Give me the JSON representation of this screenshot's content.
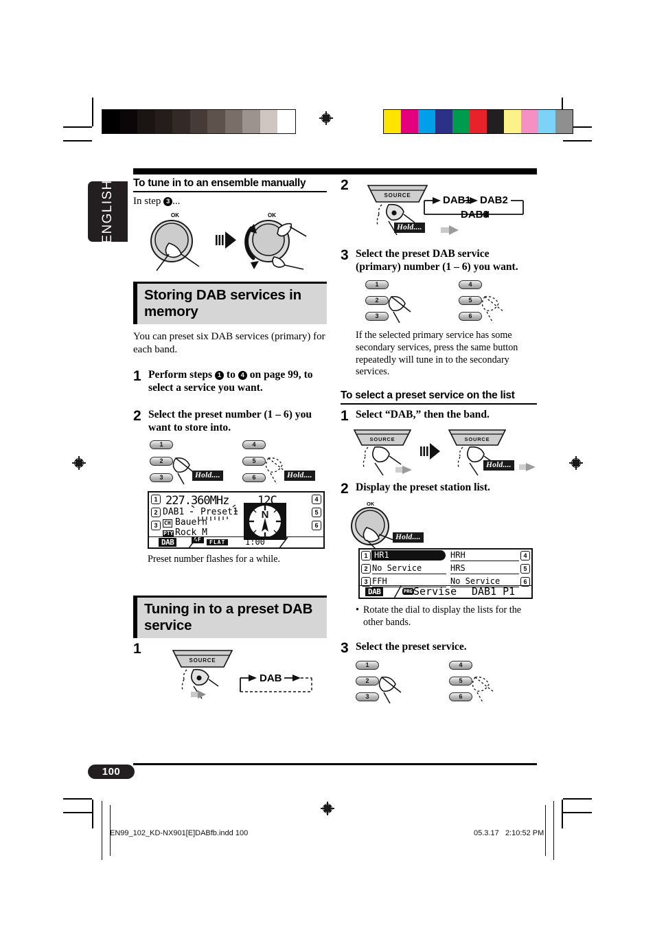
{
  "document": {
    "language_tab": "ENGLISH",
    "page_number": "100",
    "footer_file": "EN99_102_KD-NX901[E]DABfb.indd   100",
    "footer_date": "05.3.17",
    "footer_time": "2:10:52 PM"
  },
  "colors": {
    "accent_band_bg": "#d6d6d6",
    "rule_black": "#000000",
    "tab_black": "#231f20",
    "button_gray": "#b9b9b9",
    "hold_badge_bg": "#1a1a1a"
  },
  "color_bars": {
    "grayscale": [
      "#000000",
      "#0b0708",
      "#1a1413",
      "#241d1b",
      "#332a27",
      "#463b36",
      "#5e524c",
      "#7a6e68",
      "#9d938e",
      "#cfc6c2",
      "#ffffff"
    ],
    "process": [
      "#ffe400",
      "#e5007e",
      "#00a0e9",
      "#2b3188",
      "#009b4c",
      "#e8222a",
      "#231f20",
      "#fdf28a",
      "#f590c4",
      "#7dd3f7",
      "#8f8f8f"
    ]
  },
  "left_column": {
    "section_manual": {
      "heading": "To tune in to an ensemble manually",
      "intro_prefix": "In step",
      "intro_step": "3",
      "intro_suffix": "...",
      "dial_label_1": "OK",
      "dial_label_2": "OK"
    },
    "band_storing": {
      "title": "Storing DAB services in memory",
      "lead": "You can preset six DAB services (primary) for each band.",
      "steps": [
        {
          "number": "1",
          "text_part_1": "Perform steps",
          "circled_a": "1",
          "text_part_2": "to",
          "circled_b": "4",
          "text_part_3": "on page 99, to select a service you want."
        },
        {
          "number": "2",
          "text": "Select the preset number (1 – 6) you want to store into."
        }
      ],
      "preset_buttons": [
        "1",
        "2",
        "3",
        "4",
        "5",
        "6"
      ],
      "hold_label": "Hold....",
      "caption": "Preset number flashes for a while."
    },
    "lcd_main": {
      "preset_ids_left": [
        "1",
        "2",
        "3"
      ],
      "preset_ids_right": [
        "4",
        "5",
        "6"
      ],
      "frequency": "227.360MHz",
      "channel_number": "12C",
      "band": "DAB1",
      "preset_label": "Preset1",
      "ch_tag": "CH",
      "ch_value": "Bauern",
      "pty_tag": "PTY",
      "pty_value": "Rock M",
      "af_tag": "AF",
      "source_tag": "DAB",
      "eq_tag": "FLAT",
      "clock": "1:00",
      "compass_letter": "N"
    },
    "band_tuning": {
      "title": "Tuning in to a preset DAB service",
      "step_number": "1",
      "source_label": "SOURCE",
      "flow_label": "DAB"
    }
  },
  "right_column": {
    "step2_band": {
      "number": "2",
      "source_label": "SOURCE",
      "hold_label": "Hold....",
      "flow": [
        "DAB1",
        "DAB2",
        "DAB3"
      ]
    },
    "step3_preset": {
      "number": "3",
      "text": "Select the preset DAB service (primary) number (1 – 6) you want.",
      "preset_buttons": [
        "1",
        "2",
        "3",
        "4",
        "5",
        "6"
      ],
      "note": "If the selected primary service has some secondary services, press the same button repeatedly will tune in to the secondary services."
    },
    "section_list": {
      "heading": "To select a preset service on the list",
      "steps": [
        {
          "number": "1",
          "text": "Select “DAB,” then the band."
        },
        {
          "number": "2",
          "text": "Display the preset station list."
        },
        {
          "number": "3",
          "text": "Select the preset service."
        }
      ],
      "source_label": "SOURCE",
      "hold_label": "Hold....",
      "dial_label": "OK",
      "bullet_note": "Rotate the dial to display the lists for the other bands.",
      "preset_buttons": [
        "1",
        "2",
        "3",
        "4",
        "5",
        "6"
      ]
    },
    "lcd_list": {
      "rows": [
        {
          "id": "1",
          "name": "HR1",
          "highlighted": true
        },
        {
          "id": "2",
          "name": "No Service",
          "highlighted": false
        },
        {
          "id": "3",
          "name": "FFH",
          "highlighted": false
        },
        {
          "id": "4",
          "name": "HRH",
          "highlighted": false
        },
        {
          "id": "5",
          "name": "HRS",
          "highlighted": false
        },
        {
          "id": "6",
          "name": "No Service",
          "highlighted": false
        }
      ],
      "source_tag": "DAB",
      "prg_tag": "PRG",
      "status_text": "Servise",
      "status_band": "DAB1 P1"
    }
  }
}
